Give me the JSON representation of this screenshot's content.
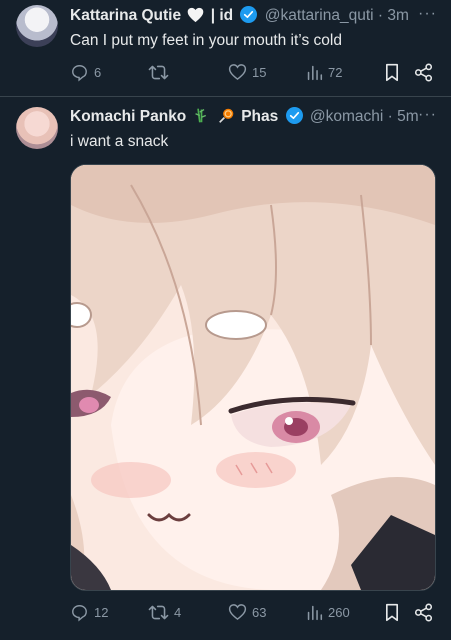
{
  "tweets": [
    {
      "name": "Kattarina Qutie",
      "name_suffix": "| id",
      "handle": "@kattarina_quti",
      "time": "3m",
      "text": "Can I put my feet in your mouth it’s cold",
      "stats": {
        "replies": "6",
        "retweets": "",
        "likes": "15",
        "views": "72"
      }
    },
    {
      "name": "Komachi Panko",
      "name_suffix": "Phas",
      "handle": "@komachi",
      "time": "5m",
      "text": "i want a snack",
      "stats": {
        "replies": "12",
        "retweets": "4",
        "likes": "63",
        "views": "260"
      }
    }
  ],
  "ui": {
    "dot": "·",
    "more": "···"
  },
  "colors": {
    "background": "#15202b",
    "verified": "#1d9bf0",
    "muted": "#8b98a5",
    "text": "#e7e9ea"
  },
  "icons": [
    "reply-icon",
    "retweet-icon",
    "like-icon",
    "views-icon",
    "bookmark-icon",
    "share-icon",
    "verified-badge-icon",
    "more-icon"
  ]
}
